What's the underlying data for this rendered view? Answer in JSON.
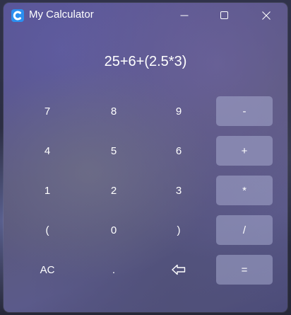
{
  "window": {
    "title": "My Calculator",
    "icon": "calculator-c-icon",
    "controls": [
      "minimize-icon",
      "maximize-icon",
      "close-icon"
    ]
  },
  "display": {
    "expression": "25+6+(2.5*3)"
  },
  "keypad": {
    "row1": [
      "7",
      "8",
      "9",
      "-"
    ],
    "row2": [
      "4",
      "5",
      "6",
      "+"
    ],
    "row3": [
      "1",
      "2",
      "3",
      "*"
    ],
    "row4": [
      "(",
      "0",
      ")",
      "/"
    ],
    "row5": [
      "AC",
      ".",
      "backspace-icon",
      "="
    ]
  },
  "colors": {
    "accent": "#2b8ff0",
    "operator_button": "#9ea3c6",
    "text": "#ffffff"
  }
}
